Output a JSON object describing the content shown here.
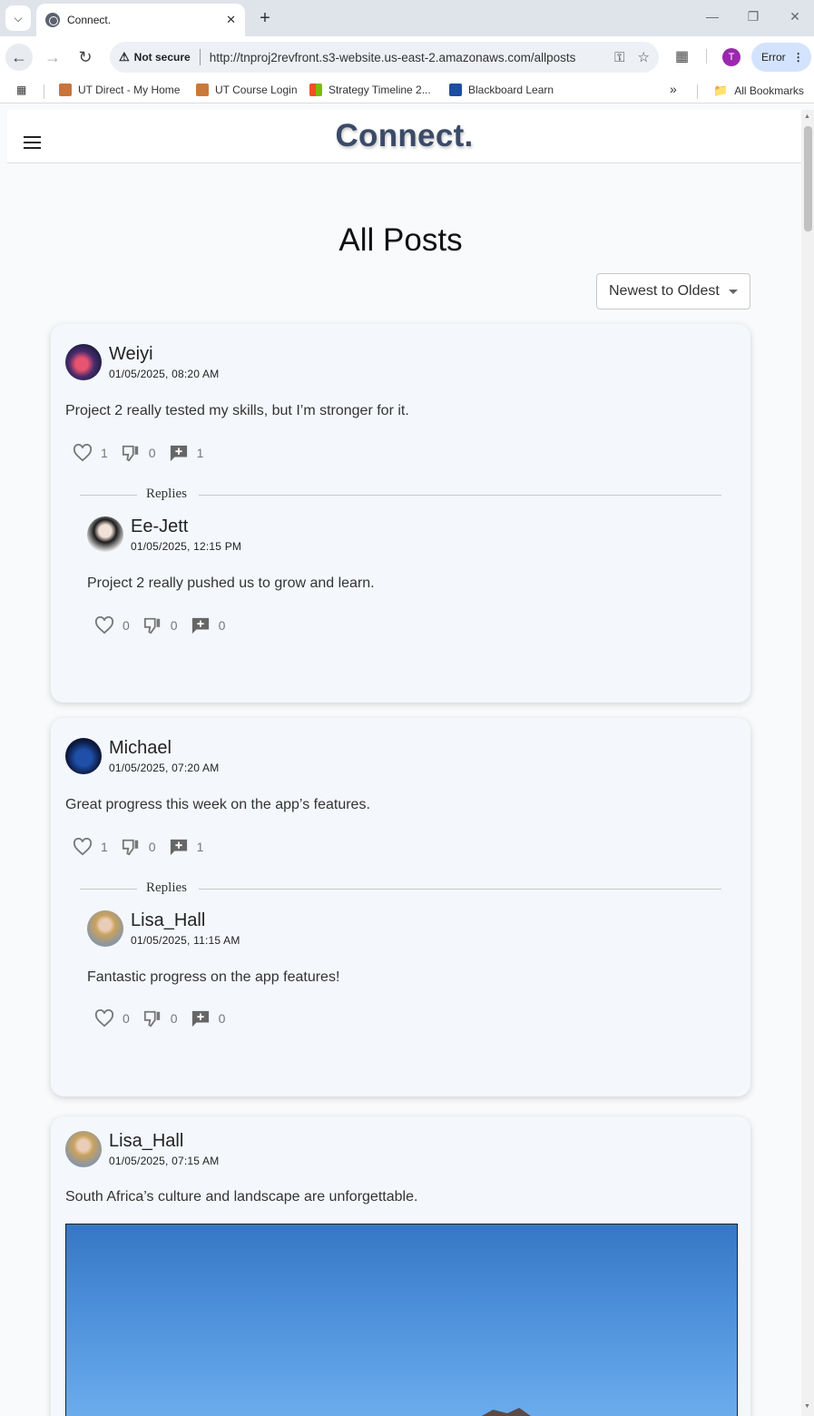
{
  "browser": {
    "tab_title": "Connect.",
    "not_secure": "Not secure",
    "url": "http://tnproj2revfront.s3-website.us-east-2.amazonaws.com/allposts",
    "profile_initial": "T",
    "error_label": "Error",
    "bookmarks": [
      {
        "label": "UT Direct - My Home",
        "color": "#c9743b"
      },
      {
        "label": "UT Course Login",
        "color": "#c97a3b"
      },
      {
        "label": "Strategy Timeline 2...",
        "color": "#f25022"
      },
      {
        "label": "Blackboard Learn",
        "color": "#1d4ea1"
      }
    ],
    "all_bookmarks": "All Bookmarks"
  },
  "app": {
    "brand": "Connect.",
    "page_title": "All Posts",
    "sort_value": "Newest to Oldest",
    "replies_label": "Replies"
  },
  "posts": [
    {
      "user": "Weiyi",
      "date": "01/05/2025, 08:20 AM",
      "text": "Project 2 really tested my skills, but I’m stronger for it.",
      "likes": "1",
      "dislikes": "0",
      "replies": "1",
      "reply": {
        "user": "Ee-Jett",
        "date": "01/05/2025, 12:15 PM",
        "text": "Project 2 really pushed us to grow and learn.",
        "likes": "0",
        "dislikes": "0",
        "replies": "0"
      }
    },
    {
      "user": "Michael",
      "date": "01/05/2025, 07:20 AM",
      "text": "Great progress this week on the app’s features.",
      "likes": "1",
      "dislikes": "0",
      "replies": "1",
      "reply": {
        "user": "Lisa_Hall",
        "date": "01/05/2025, 11:15 AM",
        "text": "Fantastic progress on the app features!",
        "likes": "0",
        "dislikes": "0",
        "replies": "0"
      }
    },
    {
      "user": "Lisa_Hall",
      "date": "01/05/2025, 07:15 AM",
      "text": "South Africa’s culture and landscape are unforgettable."
    }
  ]
}
